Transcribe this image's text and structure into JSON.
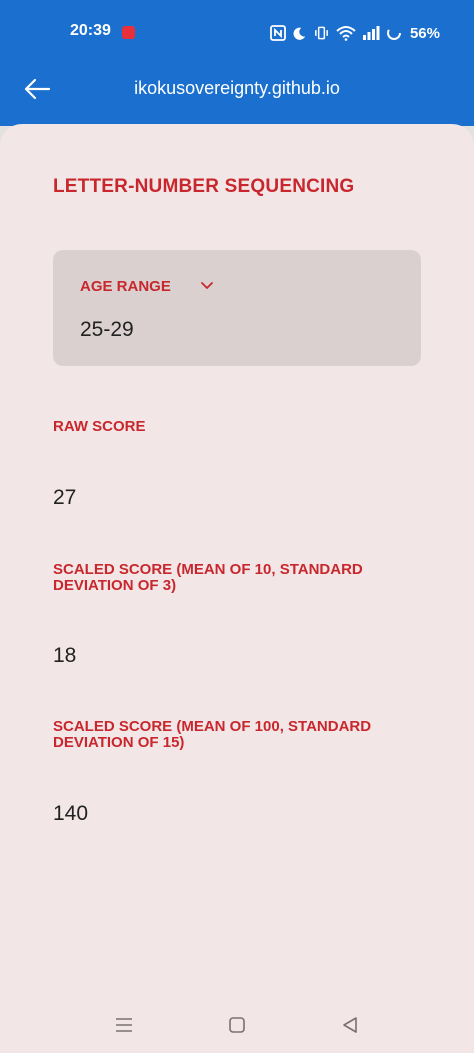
{
  "status_bar": {
    "time": "20:39",
    "battery": "56%",
    "icons": [
      "nfc-icon",
      "do-not-disturb-icon",
      "vibrate-icon",
      "wifi-icon",
      "signal-icon",
      "battery-icon"
    ]
  },
  "header": {
    "back_icon": "arrow-left-icon",
    "url": "ikokusovereignty.github.io"
  },
  "main": {
    "title": "LETTER-NUMBER SEQUENCING",
    "age_range": {
      "label": "AGE RANGE",
      "value": "25-29",
      "icon": "chevron-down-icon"
    },
    "fields": [
      {
        "label": "RAW SCORE",
        "value": "27"
      },
      {
        "label": "SCALED SCORE (MEAN OF 10, STANDARD DEVIATION OF 3)",
        "value": "18"
      },
      {
        "label": "SCALED SCORE (MEAN OF 100, STANDARD DEVIATION OF 15)",
        "value": "140"
      }
    ]
  },
  "system_nav": {
    "icons": [
      "recents-icon",
      "home-icon",
      "back-triangle-icon"
    ]
  },
  "colors": {
    "header_bg": "#1a6fcf",
    "sheet_bg": "#f3e6e7",
    "accent_red": "#c8282d",
    "card_bg": "#dad0d0"
  }
}
